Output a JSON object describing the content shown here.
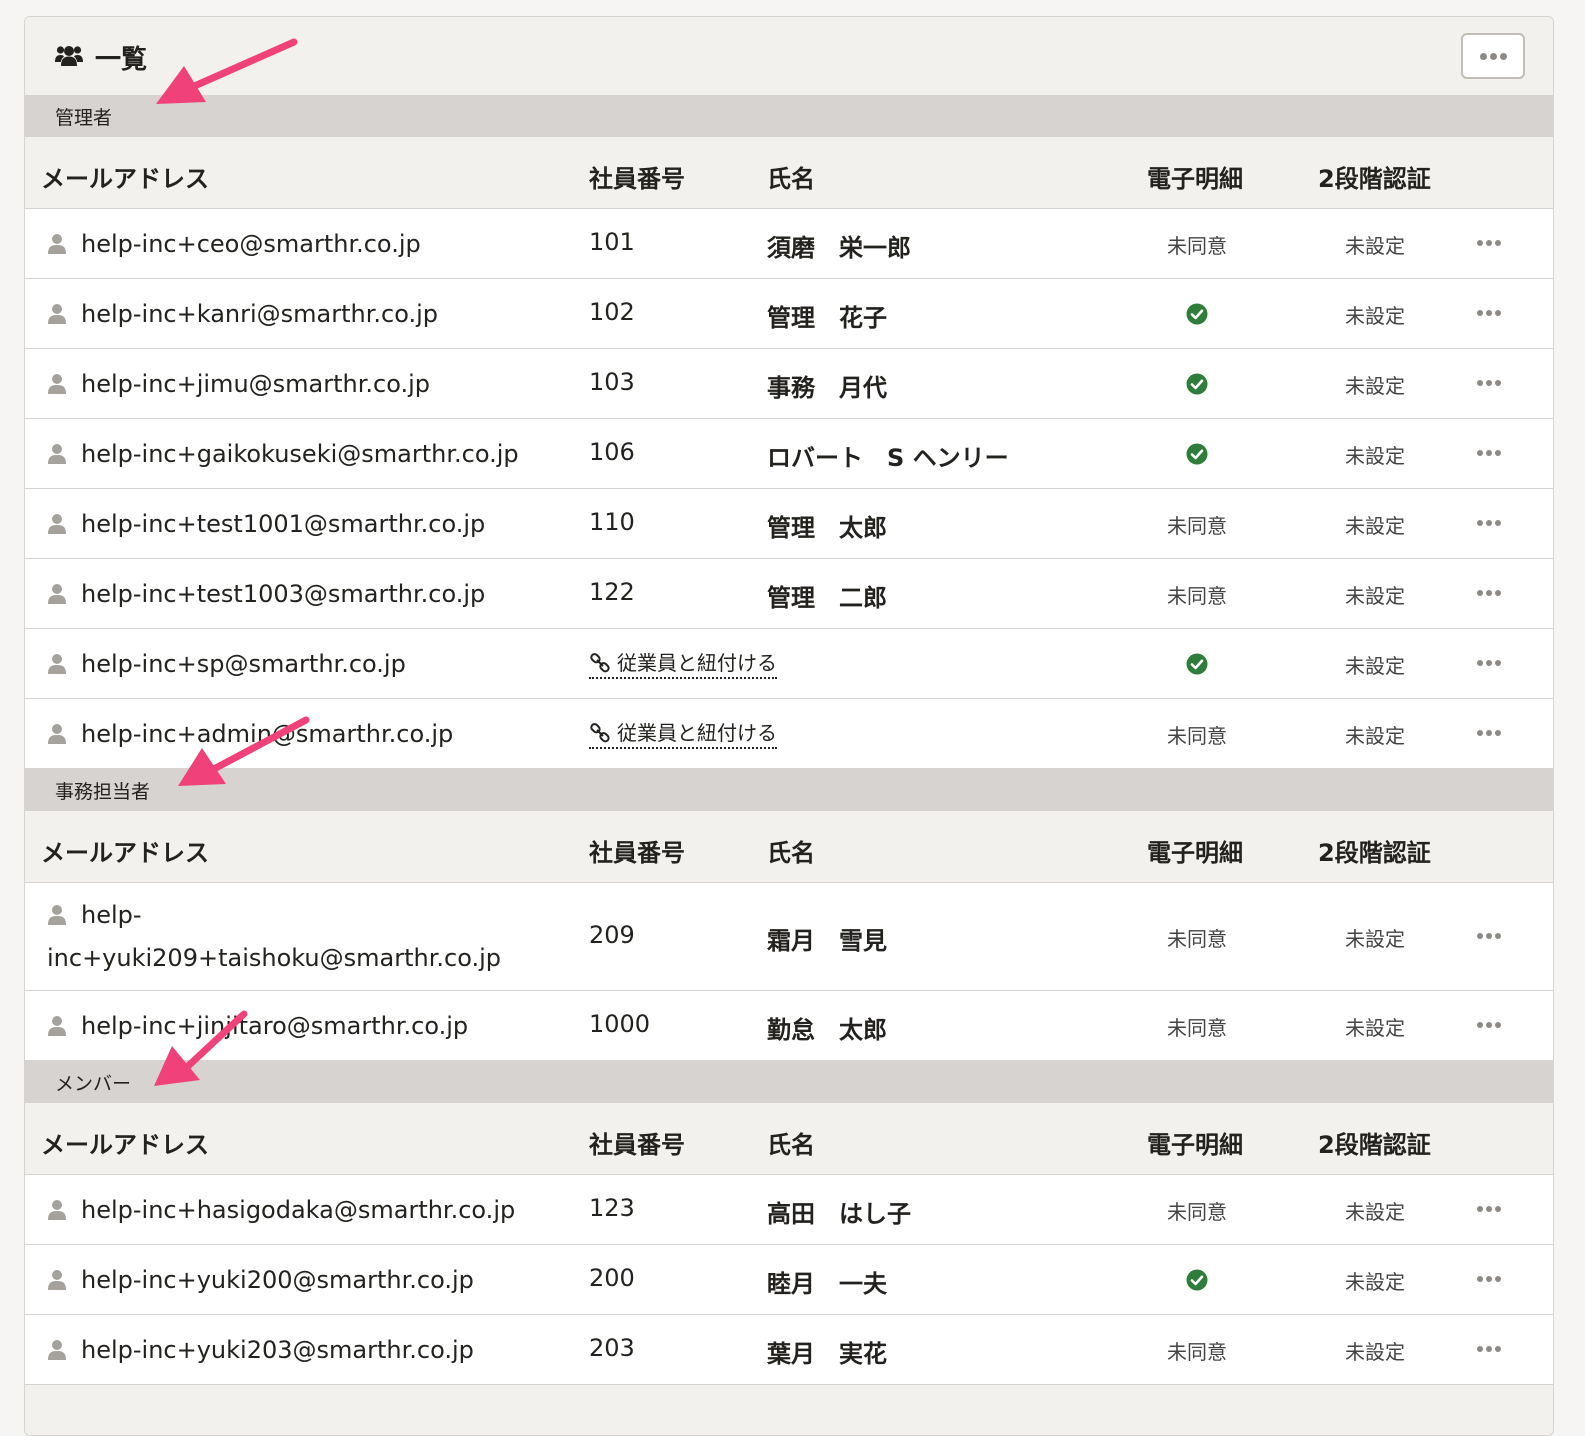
{
  "panel": {
    "title": "一覧",
    "title_icon": "users-icon",
    "menu_icon": "more-horizontal-icon"
  },
  "columns": {
    "email": "メールアドレス",
    "employee_no": "社員番号",
    "name": "氏名",
    "e_statement": "電子明細",
    "two_factor": "2段階認証"
  },
  "link_label": "従業員と紐付ける",
  "groups": [
    {
      "label": "管理者",
      "rows": [
        {
          "email": "help-inc+ceo@smarthr.co.jp",
          "no": "101",
          "name": "須磨　栄一郎",
          "consent": "未同意",
          "consented": false,
          "twofa": "未設定",
          "linked": true
        },
        {
          "email": "help-inc+kanri@smarthr.co.jp",
          "no": "102",
          "name": "管理　花子",
          "consent": "",
          "consented": true,
          "twofa": "未設定",
          "linked": true
        },
        {
          "email": "help-inc+jimu@smarthr.co.jp",
          "no": "103",
          "name": "事務　月代",
          "consent": "",
          "consented": true,
          "twofa": "未設定",
          "linked": true
        },
        {
          "email": "help-inc+gaikokuseki@smarthr.co.jp",
          "no": "106",
          "name": "ロバート　S ヘンリー",
          "consent": "",
          "consented": true,
          "twofa": "未設定",
          "linked": true
        },
        {
          "email": "help-inc+test1001@smarthr.co.jp",
          "no": "110",
          "name": "管理　太郎",
          "consent": "未同意",
          "consented": false,
          "twofa": "未設定",
          "linked": true
        },
        {
          "email": "help-inc+test1003@smarthr.co.jp",
          "no": "122",
          "name": "管理　二郎",
          "consent": "未同意",
          "consented": false,
          "twofa": "未設定",
          "linked": true
        },
        {
          "email": "help-inc+sp@smarthr.co.jp",
          "no": "",
          "name": "",
          "consent": "",
          "consented": true,
          "twofa": "未設定",
          "linked": false
        },
        {
          "email": "help-inc+admin@smarthr.co.jp",
          "no": "",
          "name": "",
          "consent": "未同意",
          "consented": false,
          "twofa": "未設定",
          "linked": false
        }
      ]
    },
    {
      "label": "事務担当者",
      "rows": [
        {
          "email": "help-inc+yuki209+taishoku@smarthr.co.jp",
          "no": "209",
          "name": "霜月　雪見",
          "consent": "未同意",
          "consented": false,
          "twofa": "未設定",
          "linked": true
        },
        {
          "email": "help-inc+jinjitaro@smarthr.co.jp",
          "no": "1000",
          "name": "勤怠　太郎",
          "consent": "未同意",
          "consented": false,
          "twofa": "未設定",
          "linked": true
        }
      ]
    },
    {
      "label": "メンバー",
      "rows": [
        {
          "email": "help-inc+hasigodaka@smarthr.co.jp",
          "no": "123",
          "name": "高田　はし子",
          "consent": "未同意",
          "consented": false,
          "twofa": "未設定",
          "linked": true
        },
        {
          "email": "help-inc+yuki200@smarthr.co.jp",
          "no": "200",
          "name": "睦月　一夫",
          "consent": "",
          "consented": true,
          "twofa": "未設定",
          "linked": true
        },
        {
          "email": "help-inc+yuki203@smarthr.co.jp",
          "no": "203",
          "name": "葉月　実花",
          "consent": "未同意",
          "consented": false,
          "twofa": "未設定",
          "linked": true
        }
      ]
    }
  ],
  "colors": {
    "accent_arrow": "#f0417a",
    "check_green": "#2f7d3a",
    "group_bar": "#d6d3d0"
  }
}
